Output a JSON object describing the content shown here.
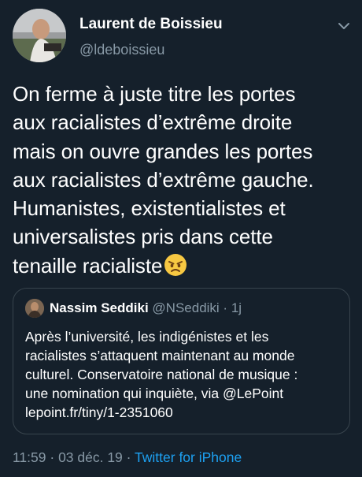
{
  "author": {
    "name": "Laurent de Boissieu",
    "handle": "@ldeboissieu"
  },
  "tweet": {
    "text": "On ferme à juste titre les portes\naux racialistes d’extrême droite\nmais on ouvre grandes les portes\naux racialistes d’extrême gauche.\nHumanistes, existentialistes et\nuniversalistes pris dans cette\ntenaille racialiste",
    "emoji": "angry-face-icon"
  },
  "quoted": {
    "name": "Nassim Seddiki",
    "handle": "@NSeddiki",
    "separator": " · ",
    "age": "1j",
    "text": "Après l’université, les indigénistes et les\nracialistes s’attaquent maintenant au monde\nculturel. Conservatoire national de musique :\nune nomination qui inquiète, via @LePoint\nlepoint.fr/tiny/1-2351060"
  },
  "footer": {
    "time": "11:59",
    "sep1": " · ",
    "date": "03 déc. 19",
    "sep2": " · ",
    "source": "Twitter for iPhone"
  },
  "colors": {
    "background": "#15202b",
    "secondary_text": "#8899a6",
    "link": "#1da1f2",
    "border": "#38444d"
  }
}
